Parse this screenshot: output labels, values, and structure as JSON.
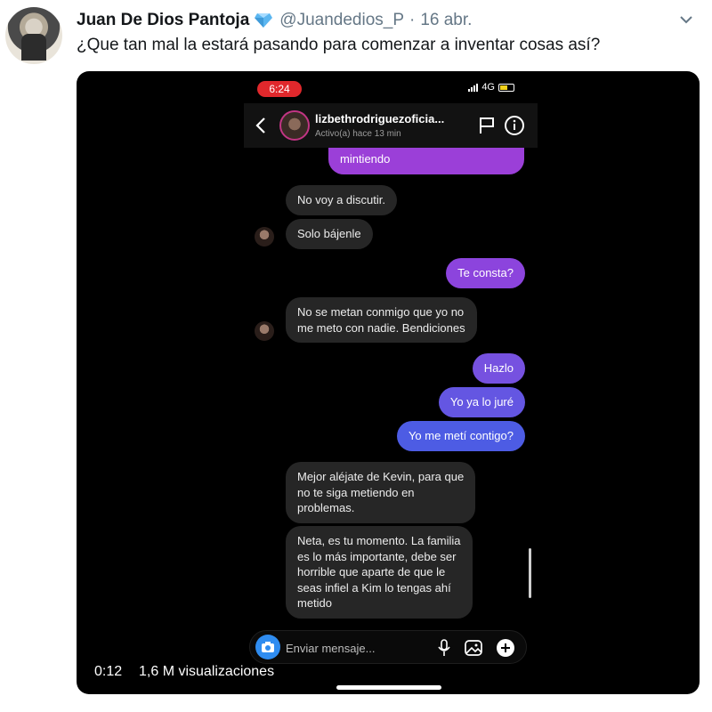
{
  "tweet": {
    "author_name": "Juan De Dios Pantoja",
    "handle": "@Juandedios_P",
    "separator": "·",
    "date": "16 abr.",
    "text": "¿Que tan mal la estará pasando para comenzar a inventar cosas así?"
  },
  "phone": {
    "status_time": "6:24",
    "network": "4G",
    "chat_username": "lizbethrodriguezoficia...",
    "chat_activity": "Activo(a) hace 13 min",
    "messages": [
      {
        "side": "sent",
        "text": "mintiendo"
      },
      {
        "side": "received",
        "text": "No voy a discutir."
      },
      {
        "side": "received",
        "text": "Solo bájenle"
      },
      {
        "side": "sent",
        "text": "Te consta?"
      },
      {
        "side": "received",
        "text": "No se metan conmigo que yo no\nme meto con nadie. Bendiciones"
      },
      {
        "side": "sent",
        "text": "Hazlo"
      },
      {
        "side": "sent",
        "text": "Yo ya lo juré"
      },
      {
        "side": "sent",
        "text": "Yo me metí contigo?"
      },
      {
        "side": "received",
        "text": "Mejor aléjate de Kevin, para que\nno te siga metiendo en\nproblemas."
      },
      {
        "side": "received",
        "text": "Neta, es tu momento. La familia\nes lo más importante, debe ser\nhorrible que aparte de que le\nseas infiel a Kim lo tengas ahí\nmetido"
      }
    ],
    "composer_placeholder": "Enviar mensaje..."
  },
  "video": {
    "time": "0:12",
    "views": "1,6 M visualizaciones"
  },
  "colors": {
    "verified_badge": "#5bb6f0",
    "sent_gradient_top": "#a23bd6",
    "sent_gradient_bottom": "#3a5be0",
    "received_bubble": "#262626",
    "status_pill": "#e0282c"
  },
  "icons": [
    "verified-icon",
    "chevron-down-icon",
    "back-arrow-icon",
    "flag-icon",
    "info-icon",
    "camera-icon",
    "microphone-icon",
    "gallery-icon",
    "plus-icon"
  ]
}
